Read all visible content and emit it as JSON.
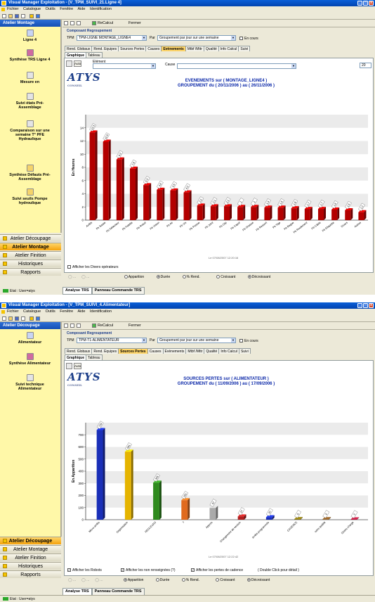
{
  "win1": {
    "title": "Visual Manager Exploitation - [V_TPM_SUIVI_21.Ligne 4]",
    "menu": [
      "Fichier",
      "Catalogue",
      "Outils",
      "Fenêtre",
      "Aide",
      "Identification"
    ],
    "toolbar": {
      "recalc": "ReCalcul",
      "close": "Fermer"
    },
    "sidebar_title": "Atelier Montage",
    "sidebar_items": [
      "Ligne 4",
      "Synthèse TRS Ligne 4",
      "Mesure en",
      "Suivi états Pré-Assemblage",
      "Comparaison sur une semaine T° PFE Hydraulique",
      "Synthèse Défauts Pré-Assemblage",
      "Suivi seuils Pompe hydroulique"
    ],
    "nav": [
      "Atelier Découpage",
      "Atelier Montage",
      "Atelier Finition",
      "Historiques",
      "Rapports"
    ],
    "nav_active": 1,
    "composant_label": "Composant   Regroupement",
    "tpm_label": "TPM",
    "tpm_value": "TPM-LIGNE MONTAGE_LIGNE4",
    "par_label": "Par",
    "par_value": "Groupement par jour sur une semaine",
    "en_cours": "En cours",
    "tabs": [
      "Rend. Globaux",
      "Rend. Equipes",
      "Sources Pertes",
      "Causes",
      "Evènements",
      "Mtbf /Mttr",
      "Qualité",
      "Info Calcul",
      "Suivi"
    ],
    "tab_active": 4,
    "subtabs": [
      "Graphique",
      "Tableau"
    ],
    "element_label": "Elément",
    "cause_label": "Cause",
    "counter": "20",
    "auto_label": "Auto",
    "logo": "ATYS",
    "logo_sub": "CONSEIL",
    "chart_title1": "EVENEMENTS sur ( MONTAGE_LIGNE4 )",
    "chart_title2": "GROUPEMENT du ( 20/11/2006 ) au ( 26/11/2006 )",
    "timestamp": "Le 07/08/2007 12:20:16",
    "show_divers": "Afficher les Divers opérateurs",
    "radios": [
      "Apparition",
      "Durée",
      "% Rend.",
      "Croissant",
      "Décroissant"
    ],
    "radios_on": [
      1,
      4
    ],
    "bottom_tabs": [
      "Analyse TRS",
      "Panneau Commande TRS"
    ],
    "status": [
      "Etat : User=atys"
    ]
  },
  "win2": {
    "title": "Visual Manager Exploitation - [V_TPM_SUIVI_4.Alimentateur]",
    "menu": [
      "Fichier",
      "Catalogue",
      "Outils",
      "Fenêtre",
      "Aide",
      "Identification"
    ],
    "toolbar": {
      "recalc": "ReCalcul",
      "close": "Fermer"
    },
    "sidebar_title": "Atelier Découpage",
    "sidebar_items": [
      "Alimentateur",
      "Synthèse Alimentateur",
      "Suivi technique Alimentateur"
    ],
    "nav": [
      "Atelier Découpage",
      "Atelier Montage",
      "Atelier Finition",
      "Historiques",
      "Rapports"
    ],
    "nav_active": 0,
    "composant_label": "Composant   Regroupement",
    "tpm_label": "TPM",
    "tpm_value": "TPM-T1-ALIMENTATEUR",
    "par_label": "Par",
    "par_value": "Groupement par jour sur une semaine",
    "en_cours": "En cours",
    "tabs": [
      "Rend. Globaux",
      "Rend. Equipes",
      "Sources Pertes",
      "Causes",
      "Evènements",
      "Mtbf /Mttr",
      "Qualité",
      "Info Calcul",
      "Suivi"
    ],
    "tab_active": 2,
    "subtabs": [
      "Graphique",
      "Tableau"
    ],
    "auto_label": "Auto",
    "logo": "ATYS",
    "logo_sub": "CONSEIL",
    "chart_title1": "SOURCES PERTES sur ( ALIMENTATEUR )",
    "chart_title2": "GROUPEMENT du ( 11/09/2006 ) au ( 17/09/2006 )",
    "timestamp": "Le 07/08/2007 12:22:42",
    "checks": [
      "Afficher les Robots",
      "Afficher les non renseignées (?)",
      "Afficher les pertes de cadence"
    ],
    "dblclick": "( Double Click pour détail )",
    "radios": [
      "Apparition",
      "Durée",
      "% Rend.",
      "Croissant",
      "Décroissant"
    ],
    "radios_on": [
      0,
      4
    ],
    "bottom_tabs": [
      "Analyse TRS",
      "Panneau Commande TRS"
    ],
    "status": [
      "Etat : User=atys"
    ]
  },
  "chart_data": [
    {
      "type": "bar",
      "title": "EVENEMENTS sur ( MONTAGE_LIGNE4 ) GROUPEMENT du ( 20/11/2006 ) au ( 26/11/2006 )",
      "ylabel": "En Heures",
      "ylim": [
        0,
        16
      ],
      "yticks": [
        0,
        2,
        4,
        6,
        8,
        10,
        12,
        14
      ],
      "categories": [
        "Arrêts",
        "Pb Saisie",
        "Pb Détecteur",
        "Pb Palette",
        "Pb Robot",
        "Pb Vision",
        "Pb Air",
        "Pb Vis",
        "Pb Presse",
        "Pb Joint",
        "Pb Clip",
        "Pb Capot",
        "Pb Graisse",
        "Pb Ressort",
        "Pb Tige",
        "Pb Bague",
        "Pb Roulement",
        "Pb Câble",
        "Pb Etiquette",
        "Divers",
        "Autres"
      ],
      "values": [
        13.3,
        11.9,
        9.2,
        7.8,
        5.3,
        4.6,
        4.5,
        4.2,
        2.2,
        2.1,
        2.1,
        2.0,
        2.0,
        1.9,
        1.9,
        1.8,
        1.7,
        1.7,
        1.6,
        1.5,
        1.2
      ],
      "colors": {
        "bar": "#b30000",
        "band": "#e8e8e8"
      }
    },
    {
      "type": "bar",
      "title": "SOURCES PERTES sur ( ALIMENTATEUR ) GROUPEMENT du ( 11/09/2006 ) au ( 17/09/2006 )",
      "ylabel": "En Apparition",
      "ylim": [
        0,
        800
      ],
      "yticks": [
        0,
        100,
        200,
        300,
        400,
        500,
        600,
        700
      ],
      "categories": [
        "Micro-arrêts",
        "Organisation",
        "REGLEURS",
        "?",
        "Appros",
        "Changement de version",
        "Arrêts programmés",
        "CADENCE",
        "sans qualité",
        "Divers charge"
      ],
      "values": [
        739,
        561,
        305,
        161,
        97,
        27,
        20,
        5,
        4,
        3
      ],
      "colors": [
        "#1a2fb8",
        "#e5b400",
        "#2e8a1e",
        "#e06a1e",
        "#aaaaaa",
        "#b02020",
        "#1a2fb8",
        "#7a6a10",
        "#7a5020",
        "#a01a3a"
      ]
    }
  ]
}
